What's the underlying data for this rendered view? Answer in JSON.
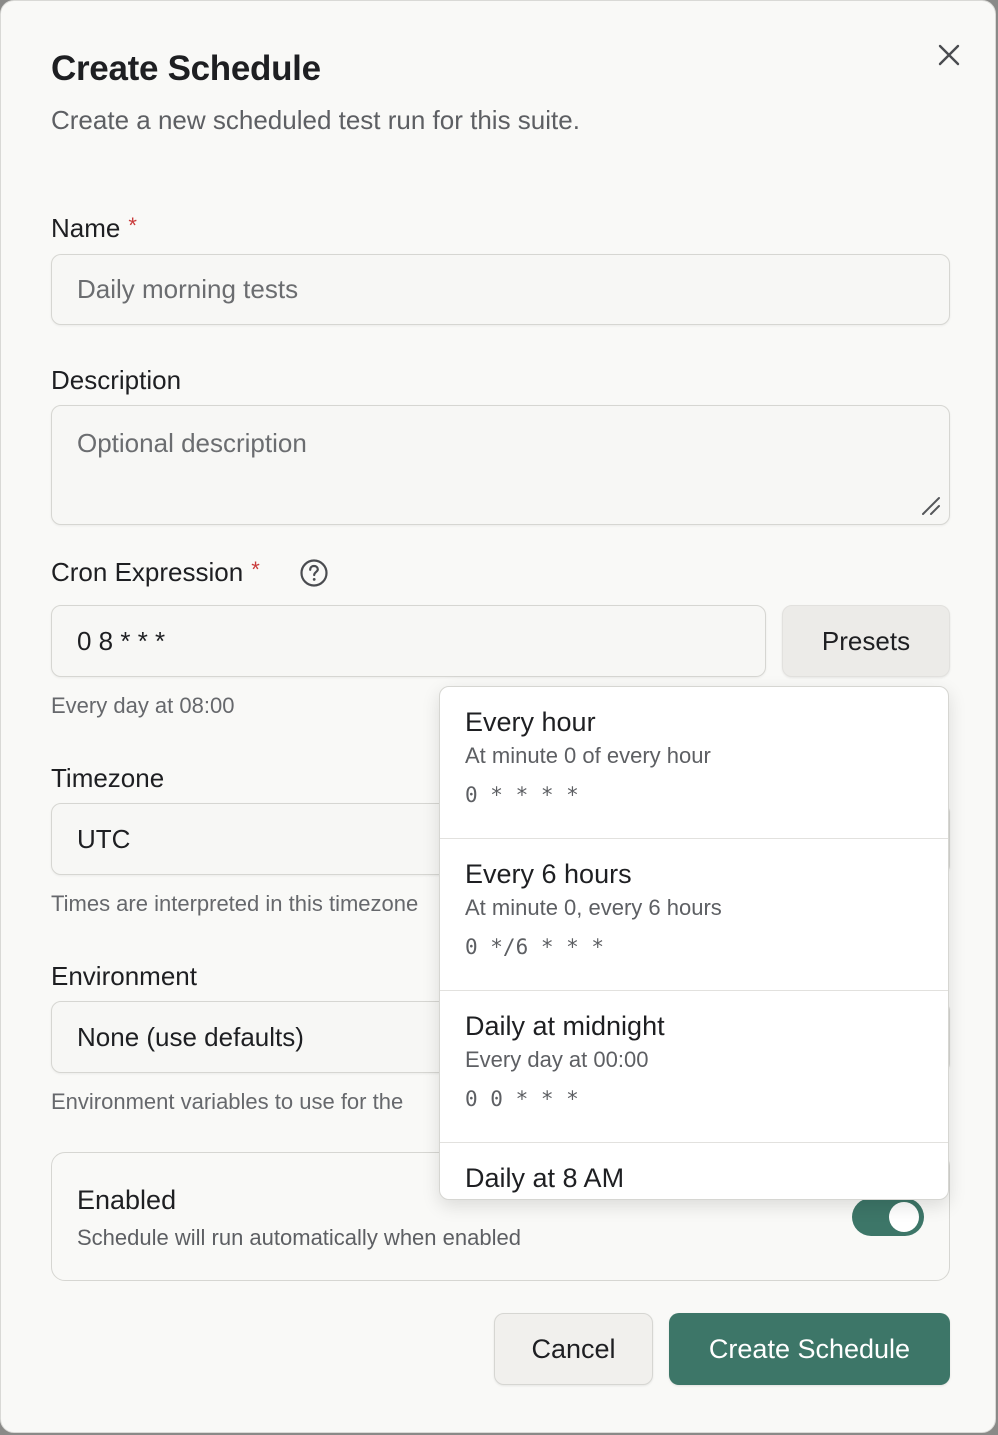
{
  "dialog": {
    "title": "Create Schedule",
    "subtitle": "Create a new scheduled test run for this suite."
  },
  "name_field": {
    "label": "Name",
    "required_marker": "*",
    "placeholder": "Daily morning tests"
  },
  "description_field": {
    "label": "Description",
    "placeholder": "Optional description"
  },
  "cron_field": {
    "label": "Cron Expression",
    "required_marker": "*",
    "value": "0 8 * * *",
    "hint": "Every day at 08:00",
    "presets_label": "Presets"
  },
  "timezone_field": {
    "label": "Timezone",
    "value": "UTC",
    "hint": "Times are interpreted in this timezone"
  },
  "environment_field": {
    "label": "Environment",
    "value": "None (use defaults)",
    "hint": "Environment variables to use for the"
  },
  "enabled_card": {
    "title": "Enabled",
    "description": "Schedule will run automatically when enabled",
    "toggle_on": true
  },
  "footer": {
    "cancel_label": "Cancel",
    "create_label": "Create Schedule"
  },
  "presets": [
    {
      "name": "Every hour",
      "description": "At minute 0 of every hour",
      "cron": "0 * * * *"
    },
    {
      "name": "Every 6 hours",
      "description": "At minute 0, every 6 hours",
      "cron": "0 */6 * * *"
    },
    {
      "name": "Daily at midnight",
      "description": "Every day at 00:00",
      "cron": "0 0 * * *"
    },
    {
      "name": "Daily at 8 AM",
      "description": "",
      "cron": ""
    }
  ],
  "colors": {
    "accent": "#3d7668",
    "required": "#c93a3a"
  }
}
